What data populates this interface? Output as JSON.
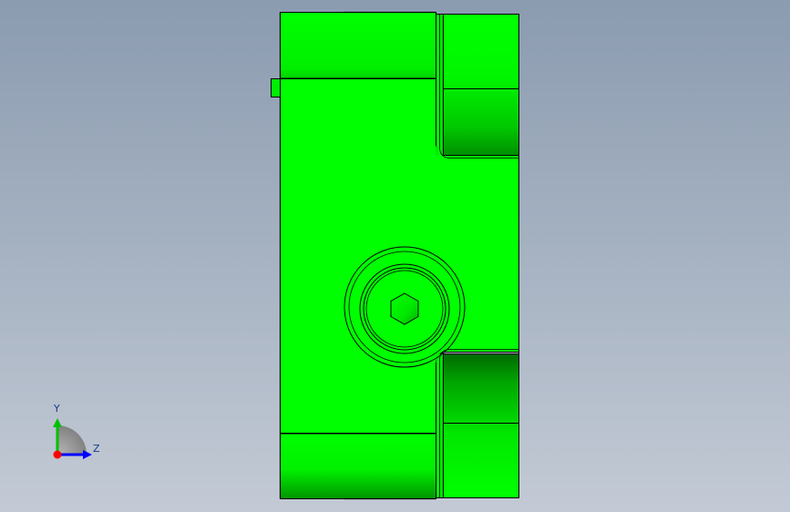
{
  "viewport": {
    "background_top": "#8b9bb0",
    "background_bottom": "#c3cad5"
  },
  "model": {
    "face_color": "#00ff00",
    "edge_color": "#000000"
  },
  "triad": {
    "y_label": "Y",
    "z_label": "Z",
    "y_color": "#00c000",
    "z_color": "#0000ff",
    "x_color": "#ff0000",
    "label_color": "#1a3a8a"
  }
}
